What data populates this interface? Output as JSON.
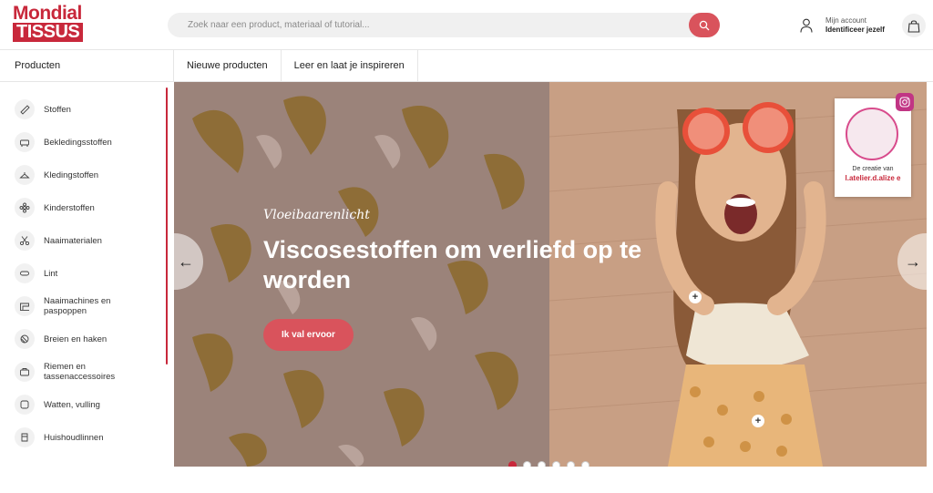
{
  "header": {
    "logo_line1": "Mondial",
    "logo_line2": "TISSUS",
    "search_placeholder": "Zoek naar een product, materiaal of tutorial...",
    "account_label": "Mijn account",
    "account_action": "Identificeer jezelf"
  },
  "nav": {
    "products_label": "Producten",
    "tabs": [
      {
        "label": "Nieuwe producten"
      },
      {
        "label": "Leer en laat je inspireren"
      }
    ]
  },
  "sidebar": {
    "items": [
      {
        "label": "Stoffen",
        "icon": "fabric-icon"
      },
      {
        "label": "Bekledingsstoffen",
        "icon": "sofa-icon"
      },
      {
        "label": "Kledingstoffen",
        "icon": "hanger-icon"
      },
      {
        "label": "Kinderstoffen",
        "icon": "flower-icon"
      },
      {
        "label": "Naaimaterialen",
        "icon": "scissors-icon"
      },
      {
        "label": "Lint",
        "icon": "ribbon-icon"
      },
      {
        "label": "Naaimachines en paspoppen",
        "icon": "sewing-machine-icon"
      },
      {
        "label": "Breien en haken",
        "icon": "yarn-icon"
      },
      {
        "label": "Riemen en tassenaccessoires",
        "icon": "bag-icon"
      },
      {
        "label": "Watten, vulling",
        "icon": "cushion-icon"
      },
      {
        "label": "Huishoudlinnen",
        "icon": "towel-icon"
      }
    ]
  },
  "hero": {
    "kicker": "Vloeibaarenlicht",
    "title": "Viscosestoffen om verliefd op te worden",
    "cta_label": "Ik val ervoor",
    "creator_caption": "De creatie van",
    "creator_handle": "l.atelier.d.alize e",
    "prev_arrow": "←",
    "next_arrow": "→",
    "plus_symbol": "+",
    "slides_count": 6,
    "active_slide": 1
  },
  "colors": {
    "brand": "#c8283b",
    "cta": "#d9535c"
  }
}
